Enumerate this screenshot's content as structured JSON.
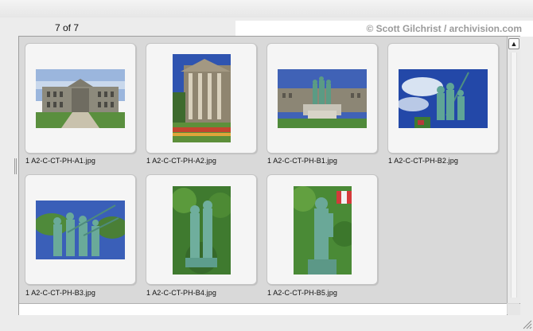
{
  "header": {
    "count_label": "7 of 7",
    "copyright": "© Scott Gilchrist / archivision.com"
  },
  "scrollbar": {
    "button_icon": "scroll-up-icon",
    "button_glyph": "▲"
  },
  "items": [
    {
      "filename": "1 A2-C-CT-PH-A1.jpg",
      "thumb": "building-facade"
    },
    {
      "filename": "1 A2-C-CT-PH-A2.jpg",
      "thumb": "building-portico"
    },
    {
      "filename": "1 A2-C-CT-PH-B1.jpg",
      "thumb": "monument-with-building"
    },
    {
      "filename": "1 A2-C-CT-PH-B2.jpg",
      "thumb": "statue-sky"
    },
    {
      "filename": "1 A2-C-CT-PH-B3.jpg",
      "thumb": "soldiers-statue"
    },
    {
      "filename": "1 A2-C-CT-PH-B4.jpg",
      "thumb": "statue-trees"
    },
    {
      "filename": "1 A2-C-CT-PH-B5.jpg",
      "thumb": "soldier-statue-flag"
    }
  ],
  "colors": {
    "panel": "#d9d9d9",
    "card": "#f5f5f5",
    "sky": "#3f63b8",
    "bronze": "#5fa596",
    "grass": "#4f8a3a"
  }
}
